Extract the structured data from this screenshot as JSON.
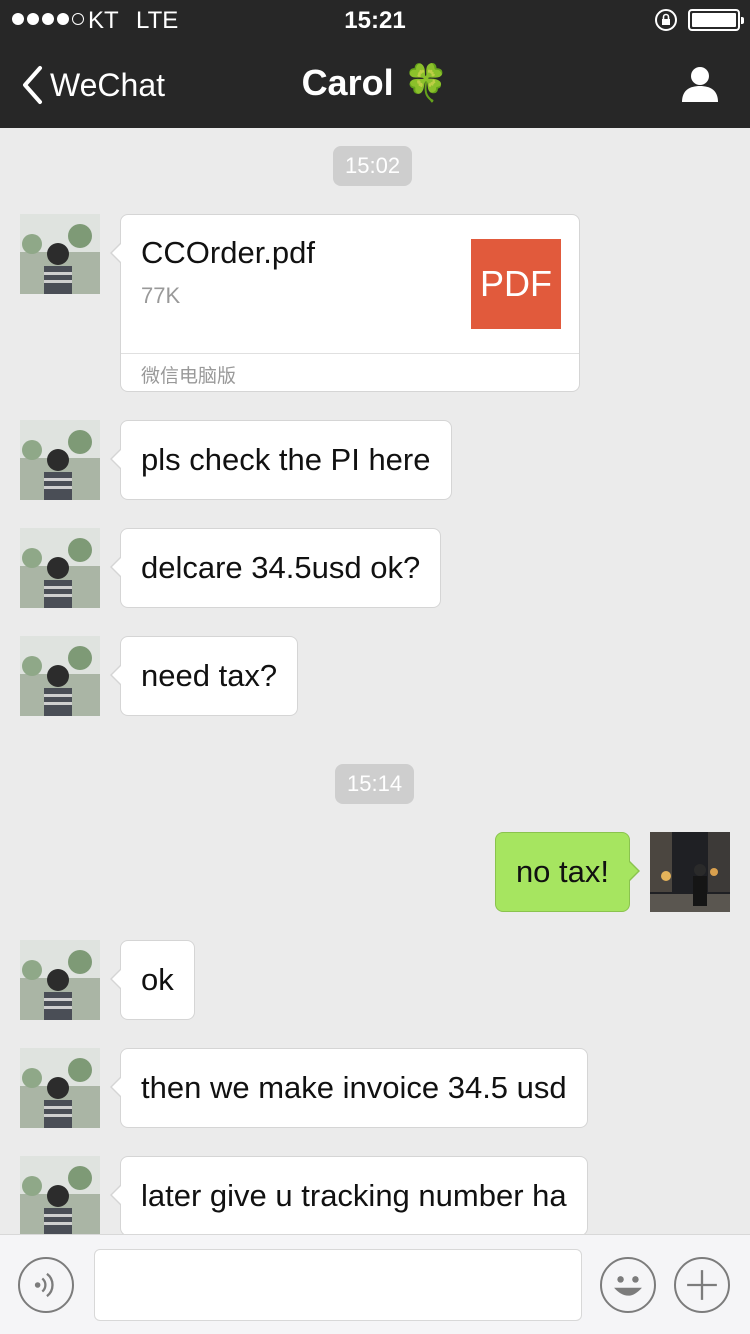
{
  "status": {
    "carrier": "KT",
    "network": "LTE",
    "time": "15:21"
  },
  "nav": {
    "back_label": "WeChat",
    "title": "Carol",
    "title_emoji": "🍀"
  },
  "messages": {
    "time1": "15:02",
    "file": {
      "name": "CCOrder.pdf",
      "size": "77K",
      "icon_label": "PDF",
      "source": "微信电脑版"
    },
    "m1": "pls check the PI here",
    "m2": "delcare 34.5usd ok?",
    "m3": "need tax?",
    "time2": "15:14",
    "m4": "no tax!",
    "m5": "ok",
    "m6": "then we make invoice 34.5 usd",
    "m7": "later give u tracking number ha"
  },
  "colors": {
    "nav_background": "#272727",
    "chat_background": "#ebebeb",
    "outgoing_bubble": "#a6e560",
    "pdf_icon": "#e15a3c"
  },
  "icons": [
    "back-chevron-icon",
    "contact-profile-icon",
    "voice-icon",
    "emoji-icon",
    "plus-icon",
    "lock-rotation-icon",
    "battery-icon"
  ]
}
